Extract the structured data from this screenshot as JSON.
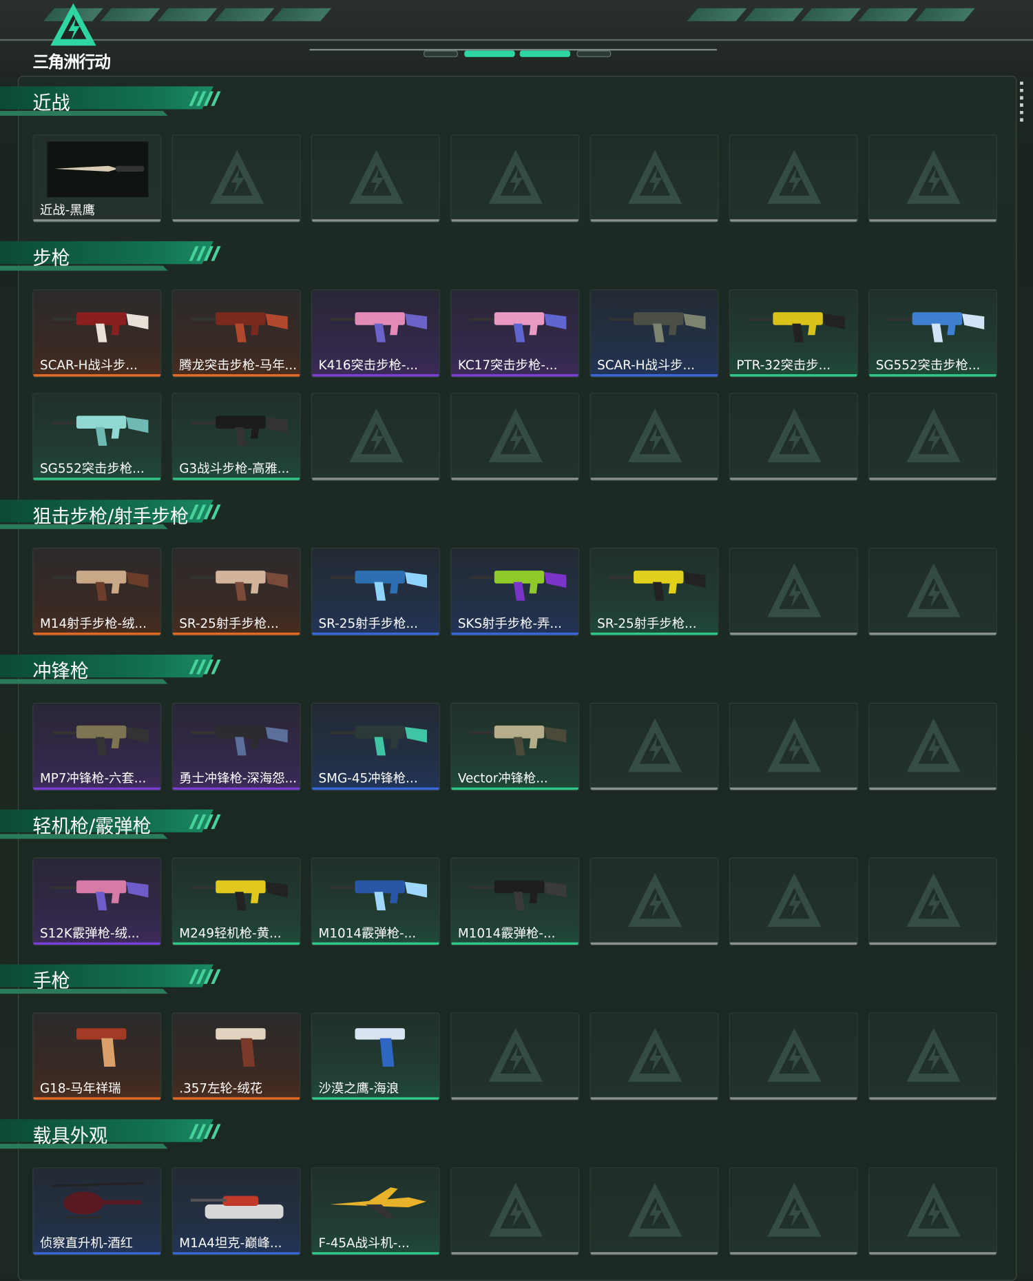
{
  "app": {
    "logo_text": "三角洲行动"
  },
  "colors": {
    "orange": "#e26a24",
    "purple": "#7b3fd6",
    "blue": "#3a66d8",
    "green": "#2fc889",
    "gray": "#8a918d"
  },
  "sections": [
    {
      "title": "近战",
      "items": [
        {
          "name": "近战-黑鹰",
          "rarity": "gray",
          "art": "knife"
        }
      ]
    },
    {
      "title": "步枪",
      "items": [
        {
          "name": "SCAR-H战斗步...",
          "rarity": "orange",
          "art": "rifle-red"
        },
        {
          "name": "腾龙突击步枪-马年...",
          "rarity": "orange",
          "art": "rifle-darkred"
        },
        {
          "name": "K416突击步枪-...",
          "rarity": "purple",
          "art": "rifle-pink"
        },
        {
          "name": "KC17突击步枪-...",
          "rarity": "purple",
          "art": "rifle-pink2"
        },
        {
          "name": "SCAR-H战斗步...",
          "rarity": "blue",
          "art": "rifle-olive"
        },
        {
          "name": "PTR-32突击步...",
          "rarity": "green",
          "art": "rifle-yellow"
        },
        {
          "name": "SG552突击步枪...",
          "rarity": "green",
          "art": "rifle-bluecamo"
        },
        {
          "name": "SG552突击步枪...",
          "rarity": "green",
          "art": "rifle-cyan"
        },
        {
          "name": "G3战斗步枪-高雅...",
          "rarity": "green",
          "art": "rifle-black"
        }
      ]
    },
    {
      "title": "狙击步枪/射手步枪",
      "items": [
        {
          "name": "M14射手步枪-绒...",
          "rarity": "orange",
          "art": "dmr-tan"
        },
        {
          "name": "SR-25射手步枪...",
          "rarity": "orange",
          "art": "dmr-tan2"
        },
        {
          "name": "SR-25射手步枪...",
          "rarity": "blue",
          "art": "dmr-blue"
        },
        {
          "name": "SKS射手步枪-弄...",
          "rarity": "blue",
          "art": "dmr-lime"
        },
        {
          "name": "SR-25射手步枪...",
          "rarity": "green",
          "art": "dmr-yellow"
        }
      ]
    },
    {
      "title": "冲锋枪",
      "items": [
        {
          "name": "MP7冲锋枪-六套...",
          "rarity": "purple",
          "art": "smg-camo"
        },
        {
          "name": "勇士冲锋枪-深海怨...",
          "rarity": "purple",
          "art": "smg-dark"
        },
        {
          "name": "SMG-45冲锋枪...",
          "rarity": "blue",
          "art": "smg-teal"
        },
        {
          "name": "Vector冲锋枪...",
          "rarity": "green",
          "art": "smg-vector"
        }
      ]
    },
    {
      "title": "轻机枪/霰弹枪",
      "items": [
        {
          "name": "S12K霰弹枪-绒...",
          "rarity": "purple",
          "art": "sg-pink"
        },
        {
          "name": "M249轻机枪-黄...",
          "rarity": "green",
          "art": "lmg-yellow"
        },
        {
          "name": "M1014霰弹枪-...",
          "rarity": "green",
          "art": "sg-blue"
        },
        {
          "name": "M1014霰弹枪-...",
          "rarity": "green",
          "art": "sg-black"
        }
      ]
    },
    {
      "title": "手枪",
      "items": [
        {
          "name": "G18-马年祥瑞",
          "rarity": "orange",
          "art": "pistol-red"
        },
        {
          "name": ".357左轮-绒花",
          "rarity": "orange",
          "art": "revolver"
        },
        {
          "name": "沙漠之鹰-海浪",
          "rarity": "green",
          "art": "deagle"
        }
      ]
    },
    {
      "title": "载具外观",
      "items": [
        {
          "name": "侦察直升机-酒红",
          "rarity": "blue",
          "art": "heli"
        },
        {
          "name": "M1A4坦克-巅峰...",
          "rarity": "blue",
          "art": "tank"
        },
        {
          "name": "F-45A战斗机-...",
          "rarity": "green",
          "art": "jet"
        }
      ]
    }
  ]
}
